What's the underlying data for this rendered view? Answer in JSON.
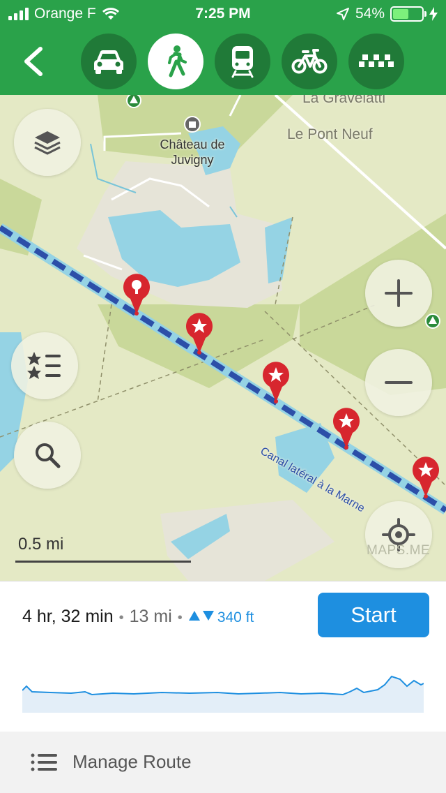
{
  "status_bar": {
    "carrier": "Orange F",
    "time": "7:25 PM",
    "battery": "54%",
    "battery_level": 0.54
  },
  "nav": {
    "back_icon": "chevron-left-icon",
    "modes": [
      {
        "name": "car",
        "icon": "car-icon",
        "active": false
      },
      {
        "name": "walk",
        "icon": "pedestrian-icon",
        "active": true
      },
      {
        "name": "transit",
        "icon": "train-icon",
        "active": false
      },
      {
        "name": "bike",
        "icon": "bicycle-icon",
        "active": false
      },
      {
        "name": "taxi",
        "icon": "taxi-icon",
        "active": false
      }
    ],
    "colors": {
      "bar": "#2aa24a",
      "button": "#207a38",
      "active": "#ffffff"
    }
  },
  "map": {
    "labels": {
      "chateau": "Château de Juvigny",
      "gravelatti": "La Gravelatti",
      "pont_neuf": "Le Pont Neuf",
      "canal": "Canal latéral à la Marne"
    },
    "scale": "0.5 mi",
    "watermark": "MAPS.ME",
    "buttons": {
      "layers": "layers-icon",
      "bookmarks": "bookmarks-list-icon",
      "search": "search-icon",
      "zoom_in": "plus-icon",
      "zoom_out": "minus-icon",
      "location": "my-location-icon"
    },
    "colors": {
      "land": "#e4e9c5",
      "forest": "#c9d89a",
      "water": "#95d3e4",
      "urban": "#e6e4d8",
      "route": "#2c4fa8",
      "pin": "#d7262e"
    }
  },
  "route": {
    "duration": "4 hr, 32 min",
    "distance": "13 mi",
    "elevation": "340 ft",
    "start_label": "Start",
    "start_color": "#1e8fe0"
  },
  "manage": {
    "label": "Manage Route",
    "icon": "list-icon"
  }
}
